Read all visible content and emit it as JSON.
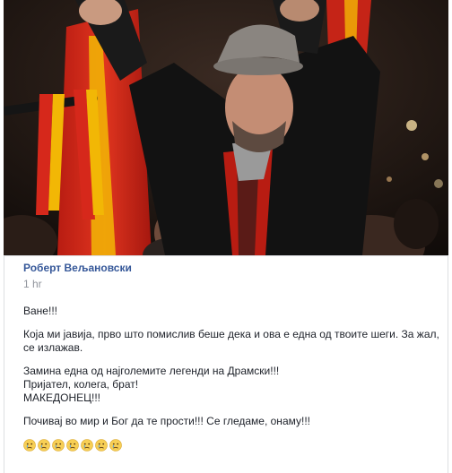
{
  "comment": {
    "author": "Роберт Вељановски",
    "time": "1 hr",
    "paragraphs": {
      "p1": "Ване!!!",
      "p2": "Која ми јавија, прво што помислив беше дека и ова е една од твоите шеги. За жал, се излажав.",
      "p3_line1": "Замина една од најголемите легенди на Драмски!!!",
      "p3_line2": "Пријател, колега, брат!",
      "p3_line3": "МАКЕДОНЕЦ!!!",
      "p4": "Почивај во мир и Бог да те прости!!! Се гледаме, онаму!!!"
    },
    "reactions": [
      "crying-face-icon",
      "crying-face-icon",
      "crying-face-icon",
      "crying-face-icon",
      "crying-face-icon",
      "crying-face-icon",
      "crying-face-icon"
    ]
  },
  "colors": {
    "author_link": "#365899",
    "timestamp": "#90949c",
    "body_text": "#1d2129",
    "flag_red": "#d6281b",
    "flag_yellow": "#f2b705"
  }
}
